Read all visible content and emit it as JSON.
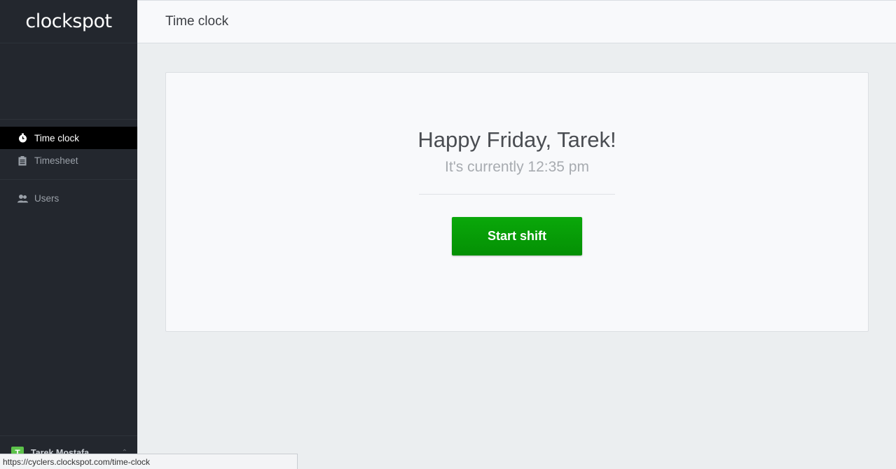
{
  "app": {
    "logo": "clockspot"
  },
  "sidebar": {
    "items": [
      {
        "label": "Time clock",
        "icon": "stopwatch-icon",
        "active": true
      },
      {
        "label": "Timesheet",
        "icon": "clipboard-icon",
        "active": false
      },
      {
        "label": "Users",
        "icon": "users-icon",
        "active": false
      }
    ],
    "user": {
      "initial": "T",
      "name": "Tarek Mostafa"
    }
  },
  "header": {
    "title": "Time clock"
  },
  "card": {
    "greeting": "Happy Friday, Tarek!",
    "current_time": "It's currently 12:35 pm",
    "start_label": "Start shift"
  },
  "status": {
    "url": "https://cyclers.clockspot.com/time-clock"
  },
  "colors": {
    "accent": "#049004",
    "sidebar": "#23272e",
    "avatar": "#5cc24a"
  }
}
